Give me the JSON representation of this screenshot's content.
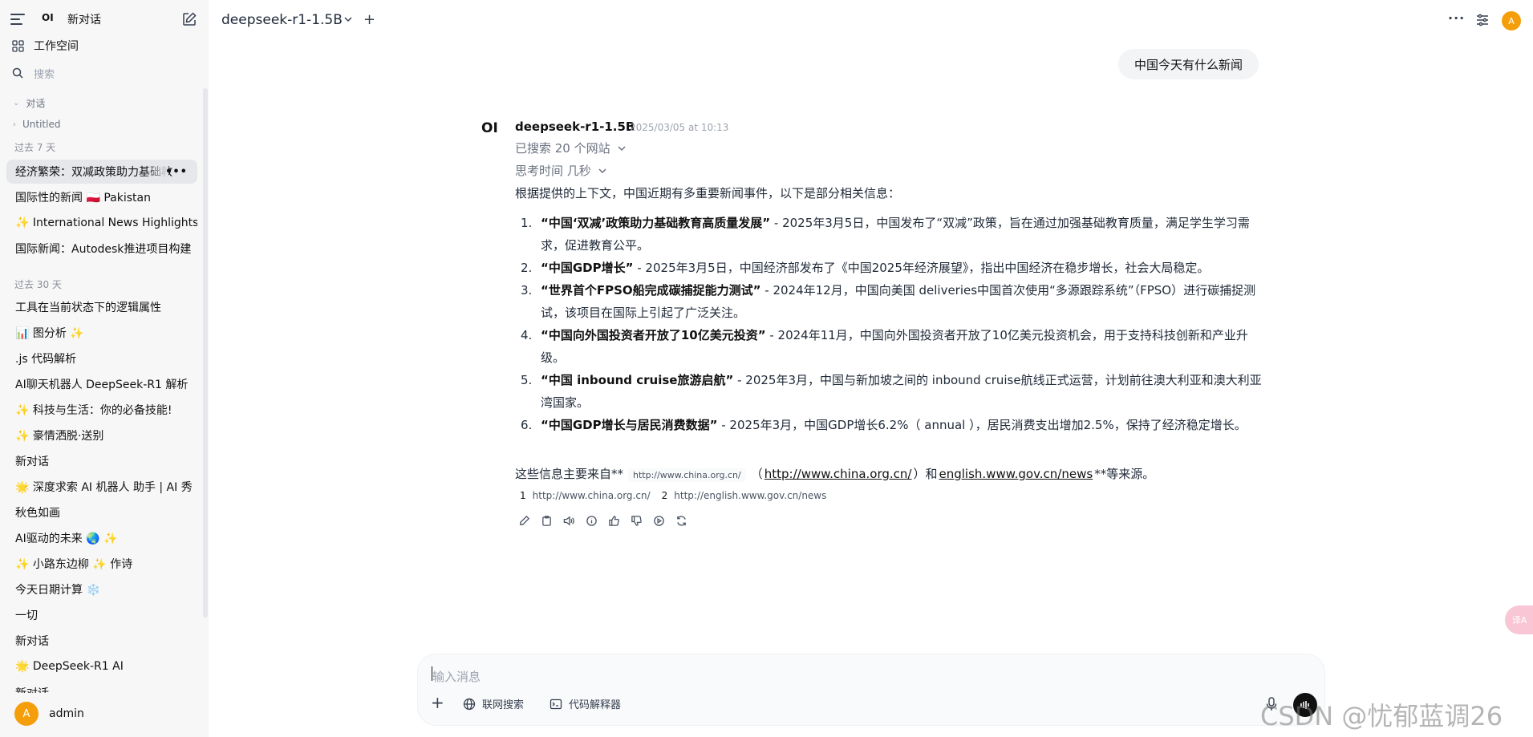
{
  "sidebar": {
    "logo": "OI",
    "new_chat_label": "新对话",
    "workspace_label": "工作空间",
    "search_placeholder": "搜索",
    "group_label": "对话",
    "untitled_label": "Untitled",
    "sections": {
      "past7": "过去 7 天",
      "past30": "过去 30 天"
    },
    "past7_items": [
      "经济繁荣：双减政策助力基础教",
      "国际性的新闻 🇵🇱 Pakistan",
      "✨ International News Highlights",
      "国际新闻：Autodesk推进项目构建"
    ],
    "past30_items": [
      "工具在当前状态下的逻辑属性",
      "📊 图分析 ✨",
      ".js 代码解析",
      "AI聊天机器人 DeepSeek-R1 解析",
      "✨ 科技与生活：你的必备技能!",
      "✨ 豪情洒脱·送别",
      "新对话",
      "🌟 深度求索 AI 机器人 助手 | AI 秀",
      "秋色如画",
      "AI驱动的未来 🌏 ✨",
      "✨ 小路东边柳 ✨ 作诗",
      "今天日期计算 ❄️",
      "一切",
      "新对话",
      "🌟 DeepSeek-R1 AI",
      "新对话"
    ],
    "user": {
      "avatar_letter": "A",
      "name": "admin"
    }
  },
  "header": {
    "model_name": "deepseek-r1-1.5B",
    "avatar_letter": "A"
  },
  "conversation": {
    "user_message": "中国今天有什么新闻",
    "bot": {
      "logo": "OI",
      "name": "deepseek-r1-1.5B",
      "timestamp": "2025/03/05 at 10:13",
      "searched_label": "已搜索 20 个网站",
      "thinking_label": "思考时间 几秒",
      "intro": "根据提供的上下文，中国近期有多重要新闻事件，以下是部分相关信息：",
      "items": [
        {
          "num": "1.",
          "title": "“中国‘双减’政策助力基础教育高质量发展”",
          "text": " - 2025年3月5日，中国发布了“双减”政策，旨在通过加强基础教育质量，满足学生学习需求，促进教育公平。"
        },
        {
          "num": "2.",
          "title": "“中国GDP增长”",
          "text": " - 2025年3月5日，中国经济部发布了《中国2025年经济展望》，指出中国经济在稳步增长，社会大局稳定。"
        },
        {
          "num": "3.",
          "title": "“世界首个FPSO船完成碳捕捉能力测试”",
          "text": " - 2024年12月，中国向美国 deliveries中国首次使用“多源跟踪系统”（FPSO）进行碳捕捉测试，该项目在国际上引起了广泛关注。"
        },
        {
          "num": "4.",
          "title": "“中国向外国投资者开放了10亿美元投资”",
          "text": " - 2024年11月，中国向外国投资者开放了10亿美元投资机会，用于支持科技创新和产业升级。"
        },
        {
          "num": "5.",
          "title": "“中国 inbound cruise旅游启航”",
          "text": " - 2025年3月，中国与新加坡之间的 inbound cruise航线正式运营，计划前往澳大利亚和澳大利亚湾国家。"
        },
        {
          "num": "6.",
          "title": "“中国GDP增长与居民消费数据”",
          "text": " - 2025年3月，中国GDP增长6.2%（ annual ），居民消费支出增加2.5%，保持了经济稳定增长。"
        }
      ],
      "sources_prefix": "这些信息主要来自**",
      "sources_chip": "http://www.china.org.cn/",
      "sources_open_paren": "（",
      "sources_link1": "http://www.china.org.cn/",
      "sources_close_and": "）和",
      "sources_link2": "english.www.gov.cn/news",
      "sources_suffix": "**等来源。",
      "citations": [
        {
          "index": "1",
          "url": "http://www.china.org.cn/"
        },
        {
          "index": "2",
          "url": "http://english.www.gov.cn/news"
        }
      ]
    }
  },
  "composer": {
    "placeholder": "输入消息",
    "web_search_label": "联网搜索",
    "code_interpreter_label": "代码解释器"
  },
  "overlay": {
    "translate_label": "译A",
    "watermark": "CSDN @忧郁蓝调26"
  },
  "colors": {
    "sidebar_bg": "#f7f7f8",
    "active_item_bg": "#e5e7eb",
    "avatar": "#f59e0b",
    "user_bubble": "#f3f4f6"
  }
}
